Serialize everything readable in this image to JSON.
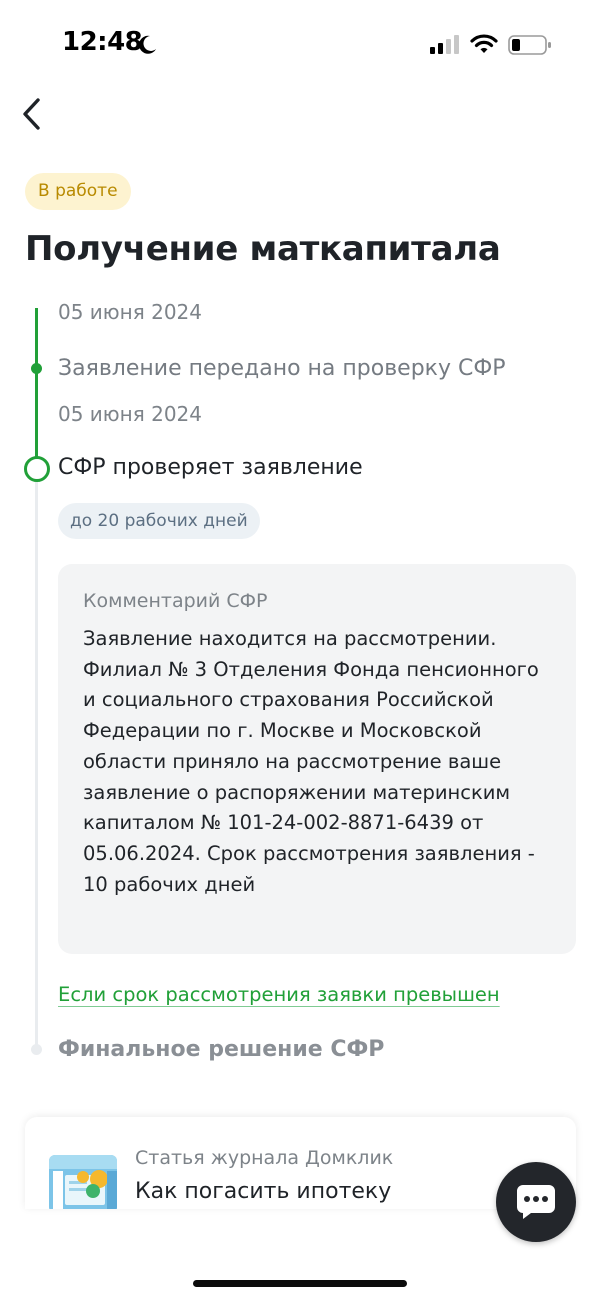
{
  "status_bar": {
    "time": "12:48",
    "icons": [
      "moon-icon",
      "cellular-signal-icon",
      "wifi-icon",
      "battery-icon"
    ]
  },
  "nav": {
    "back_icon": "chevron-left-icon"
  },
  "header": {
    "status_badge": "В работе",
    "title": "Получение маткапитала"
  },
  "timeline": {
    "clipped_date": "05 июня 2024",
    "done_step": {
      "title": "Заявление передано на проверку СФР",
      "date": "05 июня 2024"
    },
    "current_step": {
      "title": "СФР проверяет заявление",
      "deadline": "до 20 рабочих дней"
    },
    "comment": {
      "label": "Комментарий СФР",
      "text": "Заявление находится на рассмотрении. Филиал № 3 Отделения Фонда пенсионного и социального страхования Российской Федерации по г. Москве и Московской области приняло на рассмотрение ваше заявление о распоряжении материнским капиталом № 101-24-002-8871-6439 от 05.06.2024. Срок рассмотрения заявления - 10 рабочих дней"
    },
    "overdue_link": "Если срок рассмотрения заявки превышен",
    "pending_step": {
      "title": "Финальное решение СФР"
    }
  },
  "article": {
    "label": "Статья журнала Домклик",
    "title": "Как погасить ипотеку"
  },
  "chat": {
    "icon": "chat-bubble-icon"
  },
  "colors": {
    "accent_green": "#21a038",
    "badge_bg": "#fdf3d0",
    "badge_text": "#b88a00",
    "chip_bg": "#ecf1f5",
    "card_bg": "#f3f4f5",
    "fab_bg": "#23262b"
  }
}
